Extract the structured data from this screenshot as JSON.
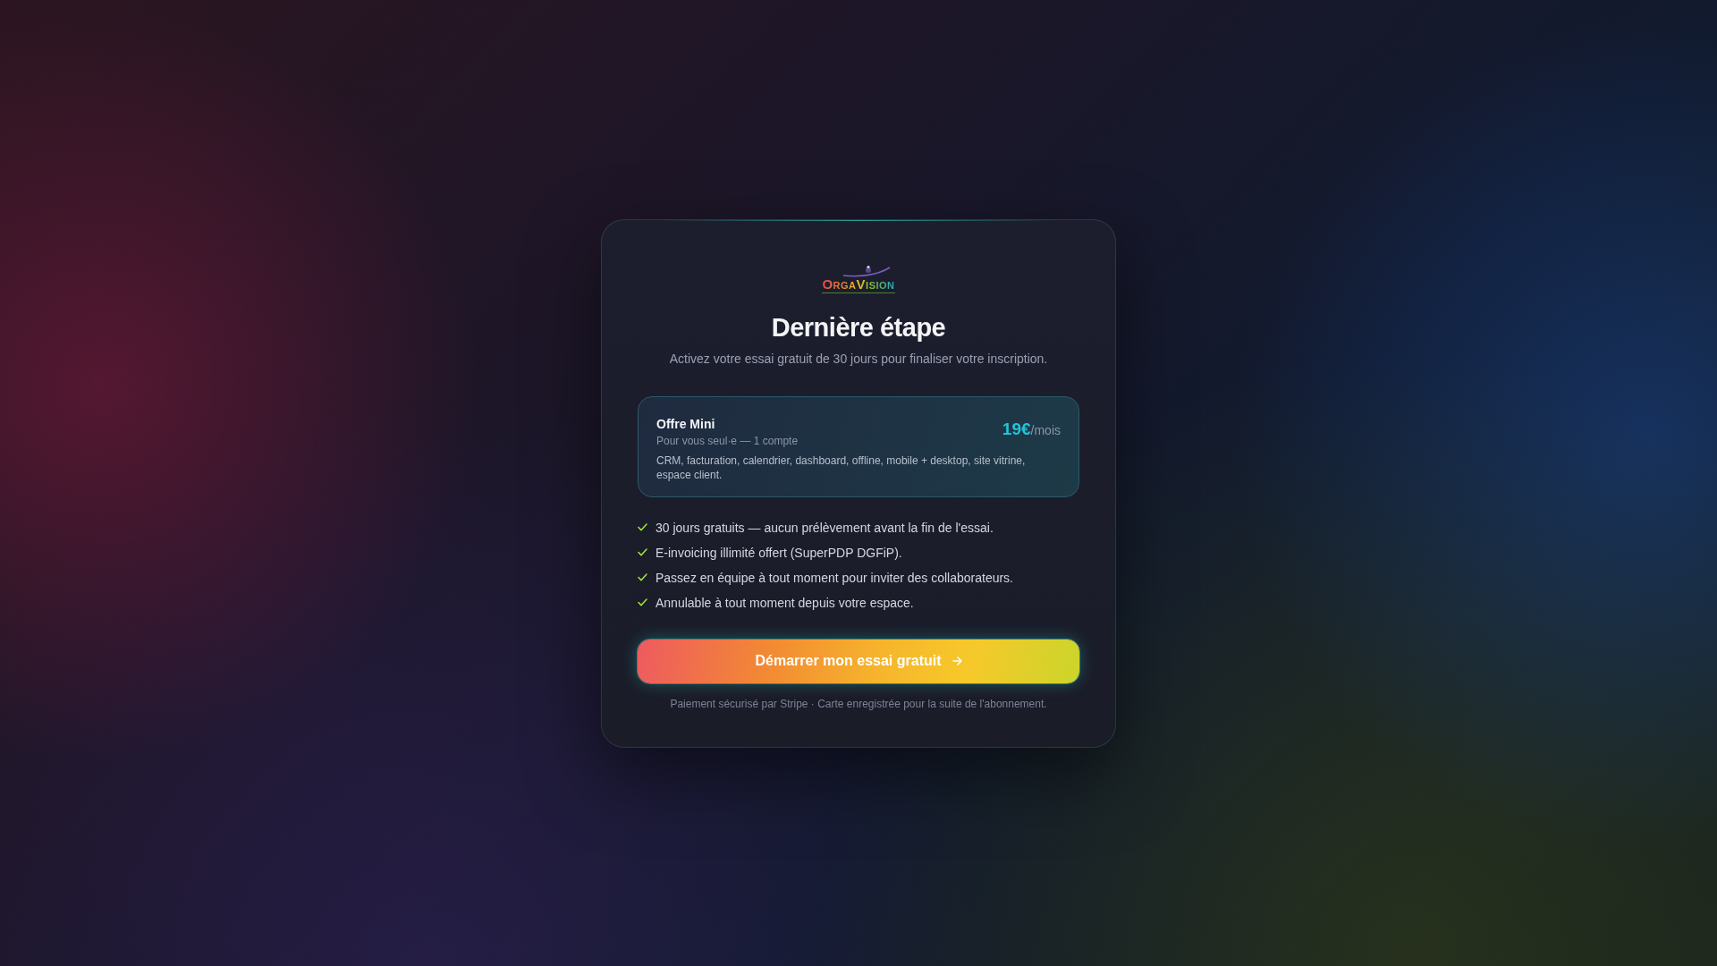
{
  "logo": {
    "text": "OrgaVision"
  },
  "title": "Dernière étape",
  "subtitle": "Activez votre essai gratuit de 30 jours pour finaliser votre inscription.",
  "offer": {
    "name": "Offre Mini",
    "audience": "Pour vous seul·e — 1 compte",
    "features": "CRM, facturation, calendrier, dashboard, offline, mobile + desktop, site vitrine, espace client.",
    "price": "19€",
    "period": "/mois"
  },
  "benefits": [
    "30 jours gratuits — aucun prélèvement avant la fin de l'essai.",
    "E-invoicing illimité offert (SuperPDP DGFiP).",
    "Passez en équipe à tout moment pour inviter des collaborateurs.",
    "Annulable à tout moment depuis votre espace."
  ],
  "cta": {
    "label": "Démarrer mon essai gratuit"
  },
  "footnote": "Paiement sécurisé par Stripe · Carte enregistrée pour la suite de l'abonnement."
}
